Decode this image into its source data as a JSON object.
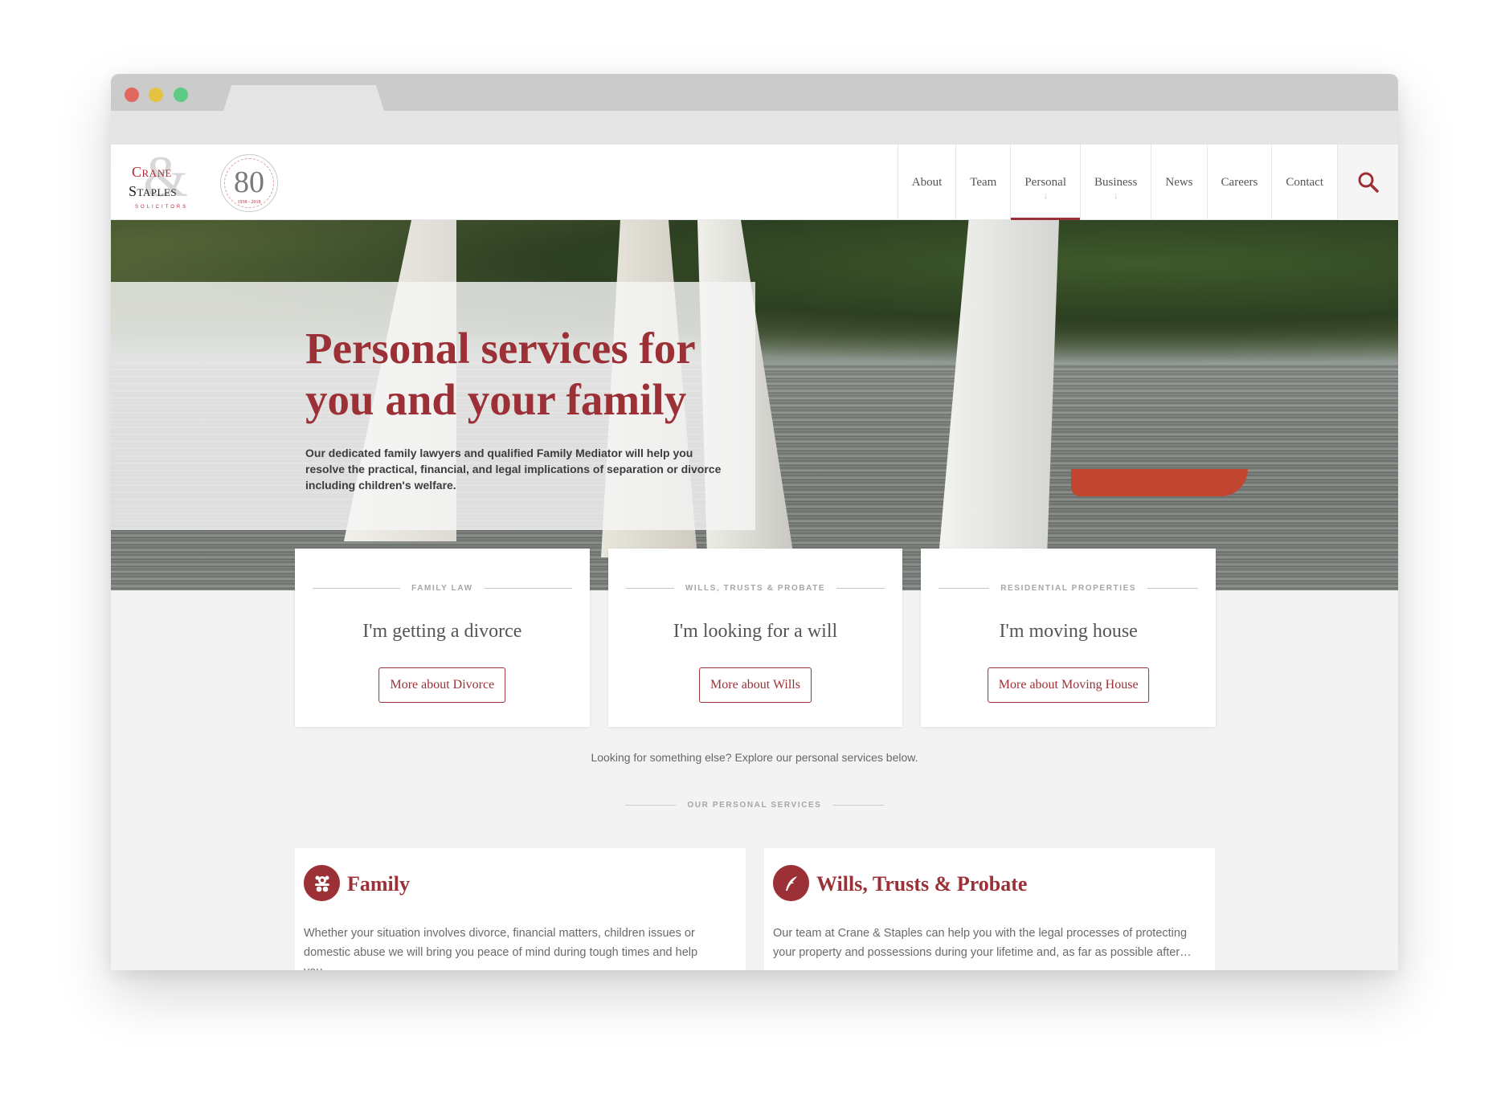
{
  "browser": {
    "window_controls": [
      "close",
      "minimize",
      "maximize"
    ]
  },
  "header": {
    "logo": {
      "line1": "Crane",
      "line2": "Staples",
      "ampersand": "&",
      "tagline": "SOLICITORS",
      "badge_number": "80",
      "badge_ring_text": "Serving the Welwyn Hatfield Community",
      "badge_years": "1938 - 2018"
    },
    "nav": [
      {
        "label": "About",
        "has_dropdown": false,
        "active": false
      },
      {
        "label": "Team",
        "has_dropdown": false,
        "active": false
      },
      {
        "label": "Personal",
        "has_dropdown": true,
        "active": true
      },
      {
        "label": "Business",
        "has_dropdown": true,
        "active": false
      },
      {
        "label": "News",
        "has_dropdown": false,
        "active": false
      },
      {
        "label": "Careers",
        "has_dropdown": false,
        "active": false
      },
      {
        "label": "Contact",
        "has_dropdown": false,
        "active": false
      }
    ],
    "dropdown_arrow": "↓",
    "search_icon": "search-icon"
  },
  "hero": {
    "title": "Personal services for you and your family",
    "description": "Our dedicated family lawyers and qualified Family Mediator will help you resolve the practical, financial, and legal implications of separation or divorce including children's welfare."
  },
  "cards": [
    {
      "kicker": "FAMILY LAW",
      "title": "I'm getting a divorce",
      "button": "More about Divorce"
    },
    {
      "kicker": "WILLS, TRUSTS & PROBATE",
      "title": "I'm looking for a will",
      "button": "More about Wills"
    },
    {
      "kicker": "RESIDENTIAL PROPERTIES",
      "title": "I'm moving house",
      "button": "More about Moving House"
    }
  ],
  "explore_text": "Looking for something else? Explore our personal services below.",
  "section_label": "OUR PERSONAL SERVICES",
  "services": [
    {
      "icon": "teddy-bear-icon",
      "title": "Family",
      "description": "Whether your situation involves divorce, financial matters, children issues or domestic abuse we will bring you peace of mind during tough times and help you…"
    },
    {
      "icon": "quill-icon",
      "title": "Wills, Trusts & Probate",
      "description": "Our team at Crane & Staples can help you with the legal processes of protecting your property and possessions during your lifetime and, as far as possible after…"
    }
  ],
  "colors": {
    "brand": "#9b3036",
    "text": "#555555",
    "muted": "#a6a6a6",
    "page_bg": "#f3f3f3"
  }
}
